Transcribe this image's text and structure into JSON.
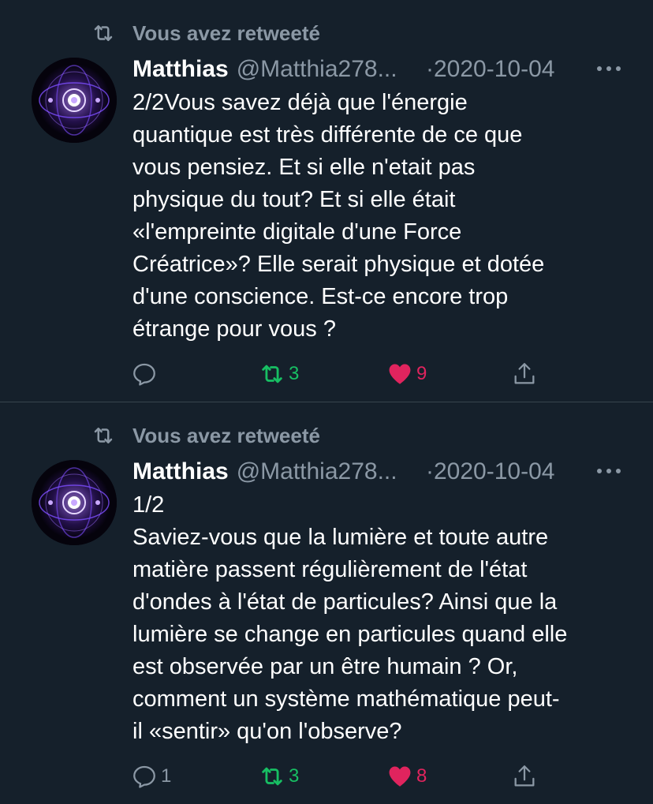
{
  "tweets": [
    {
      "retweet_label": "Vous avez retweeté",
      "author": {
        "name": "Matthias",
        "handle": "@Matthia278..."
      },
      "date": "·2020-10-04",
      "text": "2/2Vous savez déjà que l'énergie\nquantique est très différente de ce que\nvous pensiez. Et si elle n'etait pas\nphysique du tout? Et si elle était\n«l'empreinte digitale d'une Force\nCréatrice»? Elle serait physique et dotée\nd'une conscience. Est-ce encore trop\nétrange pour vous ?",
      "stats": {
        "replies": "",
        "retweets": "3",
        "likes": "9"
      }
    },
    {
      "retweet_label": "Vous avez retweeté",
      "author": {
        "name": "Matthias",
        "handle": "@Matthia278..."
      },
      "date": "·2020-10-04",
      "text": "1/2\nSaviez-vous que la lumière et toute autre\nmatière passent régulièrement de l'état\nd'ondes à l'état de particules? Ainsi que la\nlumière se change en particules quand elle\nest observée par un être humain ? Or,\ncomment un système mathématique peut-\nil «sentir» qu'on l'observe?",
      "stats": {
        "replies": "1",
        "retweets": "3",
        "likes": "8"
      }
    }
  ],
  "colors": {
    "background": "#15202b",
    "secondary_text": "#8b98a5",
    "retweet_green": "#17bf63",
    "like_pink": "#e0245e",
    "divider": "#38444d"
  },
  "icons": [
    "retweet-icon",
    "more-icon",
    "reply-icon",
    "like-icon",
    "share-icon",
    "avatar-image"
  ]
}
